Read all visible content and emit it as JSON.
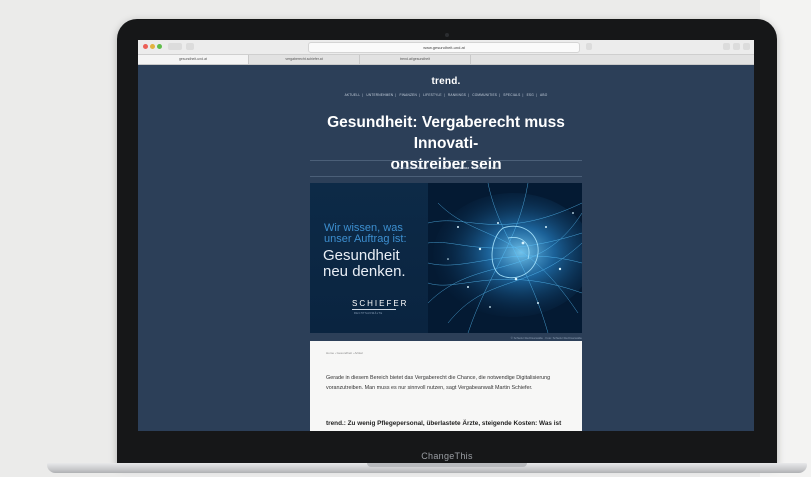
{
  "browser": {
    "url": "www.gesundheit-und.at",
    "tabs": [
      "gesundheit-und.at",
      "vergaberecht.schiefer.at",
      "trend.at/gesundheit"
    ]
  },
  "site": {
    "logo": "trend.",
    "nav": [
      "AKTUELL",
      "UNTERNEHMEN",
      "FINANZEN",
      "LIFESTYLE",
      "RANKINGS",
      "COMMUNITIES",
      "SPECIALS",
      "ESG",
      "ABO"
    ]
  },
  "article": {
    "headline_line1": "Gesundheit: Vergaberecht muss Innovati-",
    "headline_line2": "onstreiber sein",
    "meta": {
      "sponsored_label": "SPONSORED BY",
      "sponsor": "Spezial",
      "date_label": "AKTUALISIERT",
      "date": "18.09.2023",
      "read_label": "LESEZEIT",
      "read_time": "5 min"
    },
    "ad": {
      "line1": "Wir wissen, was",
      "line2": "unser Auftrag ist:",
      "line3": "Gesundheit",
      "line4": "neu denken.",
      "brand": "SCHIEFER",
      "brand_sub": "RECHTSANWÄLTE"
    },
    "image_caption": "© Schiefer Rechtsanwälte · Foto: Schiefer Rechtsanwälte",
    "breadcrumb": "Home  ›  Gesundheit  ›  Artikel",
    "lead": "Gerade in diesem Bereich bietet das Vergaberecht die Chance, die notwendige Digitalisierung voranzutreiben. Man muss es nur sinnvoll nutzen, sagt Vergabeanwalt Martin Schiefer.",
    "question": "trend.: Zu wenig Pflegepersonal, überlastete Ärzte, steigende Kosten: Was ist"
  },
  "device": {
    "brand": "ChangeThis"
  },
  "colors": {
    "page_bg": "#2c3f58",
    "ad_dark": "#041a33",
    "accent_blue": "#3d8fd0"
  }
}
